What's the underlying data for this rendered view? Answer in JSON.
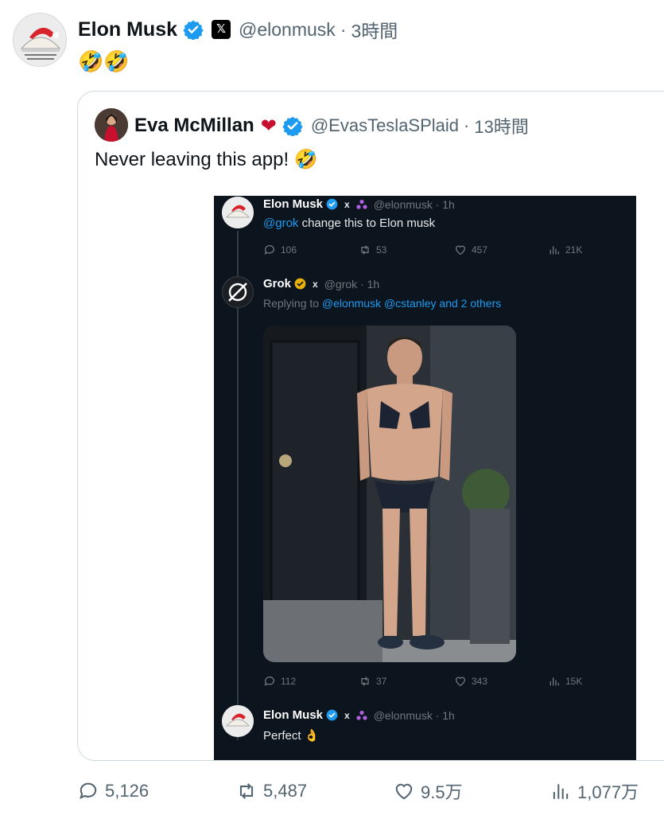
{
  "tweet": {
    "author_name": "Elon Musk",
    "handle": "@elonmusk",
    "separator": "·",
    "time": "3時間",
    "badge_label": "𝕏",
    "text": "🤣🤣",
    "verified_color": "#1d9bf0"
  },
  "quote": {
    "author_name": "Eva McMillan",
    "name_emoji": "❤",
    "handle": "@EvasTeslaSPlaid",
    "separator": "·",
    "time": "13時間",
    "text": "Never leaving this app! 🤣"
  },
  "screenshot": {
    "post1": {
      "author_name": "Elon Musk",
      "x_mark": "x",
      "handle": "@elonmusk · 1h",
      "mention": "@grok",
      "text": " change this to Elon musk",
      "replies": "106",
      "reposts": "53",
      "likes": "457",
      "views": "21K"
    },
    "post2": {
      "author_name": "Grok",
      "x_mark": "x",
      "handle": "@grok · 1h",
      "replying_prefix": "Replying to ",
      "replying_targets": "@elonmusk @cstanley and 2 others",
      "replies": "112",
      "reposts": "37",
      "likes": "343",
      "views": "15K"
    },
    "post3": {
      "author_name": "Elon Musk",
      "x_mark": "x",
      "handle": "@elonmusk · 1h",
      "text": "Perfect 👌"
    }
  },
  "actions": {
    "replies": "5,126",
    "reposts": "5,487",
    "likes": "9.5万",
    "views": "1,077万"
  },
  "icons": {
    "verified": "verified-badge-icon",
    "reply": "reply-icon",
    "repost": "repost-icon",
    "like": "heart-icon",
    "views": "views-chart-icon"
  }
}
